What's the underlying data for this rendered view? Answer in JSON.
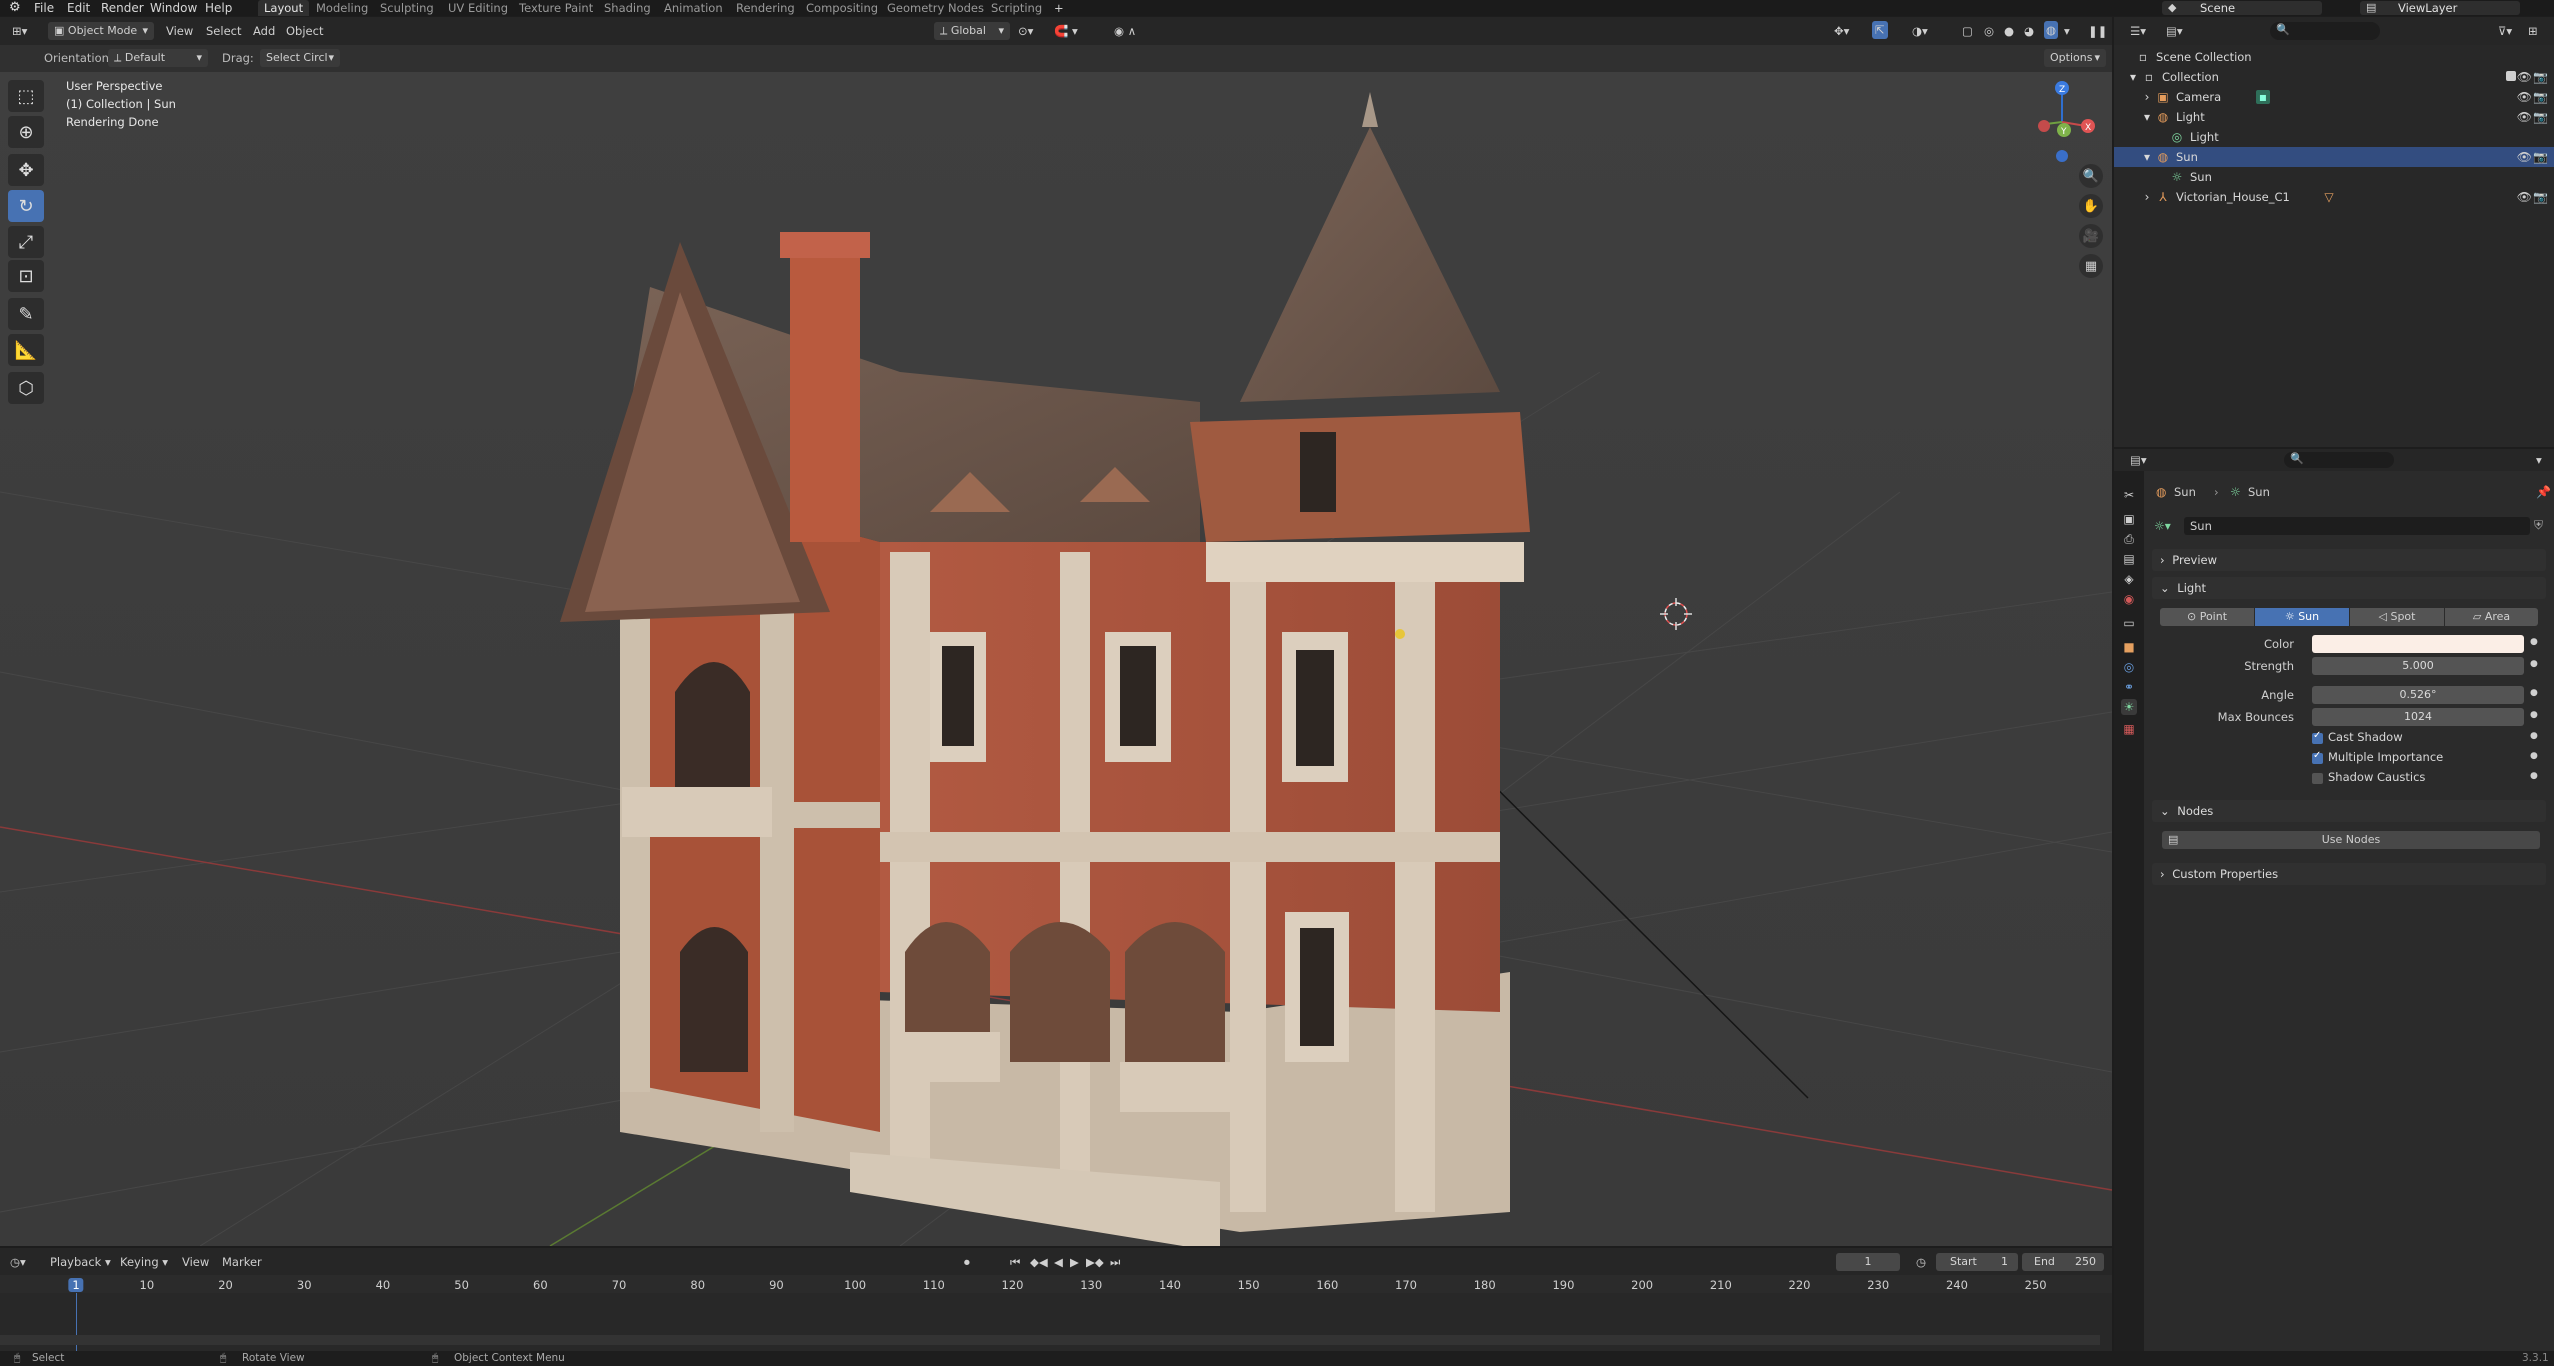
{
  "topbar": {
    "menus": [
      "File",
      "Edit",
      "Render",
      "Window",
      "Help"
    ],
    "workspaces": [
      "Layout",
      "Modeling",
      "Sculpting",
      "UV Editing",
      "Texture Paint",
      "Shading",
      "Animation",
      "Rendering",
      "Compositing",
      "Geometry Nodes",
      "Scripting"
    ],
    "active_workspace": "Layout",
    "scene_label": "Scene",
    "viewlayer_label": "ViewLayer"
  },
  "viewport_header": {
    "mode": "Object Mode",
    "menus": [
      "View",
      "Select",
      "Add",
      "Object"
    ],
    "transform_orientation": "Global",
    "orientation_label": "Orientation:",
    "orientation_value": "Default",
    "drag_label": "Drag:",
    "drag_value": "Select Circl",
    "options_label": "Options"
  },
  "viewport_info": {
    "line1": "User Perspective",
    "line2": "(1) Collection | Sun",
    "line3": "Rendering Done"
  },
  "tools": [
    "select-box",
    "cursor",
    "move",
    "rotate",
    "scale",
    "transform",
    "annotate",
    "measure",
    "add-cube"
  ],
  "active_tool": "rotate",
  "gizmo_axes": {
    "x": "X",
    "y": "Y",
    "z": "Z"
  },
  "timeline": {
    "menus": [
      "Playback",
      "Keying",
      "View",
      "Marker"
    ],
    "current_frame": "1",
    "start_label": "Start",
    "start": "1",
    "end_label": "End",
    "end": "250",
    "ruler": [
      "1",
      "10",
      "20",
      "30",
      "40",
      "50",
      "60",
      "70",
      "80",
      "90",
      "100",
      "110",
      "120",
      "130",
      "140",
      "150",
      "160",
      "170",
      "180",
      "190",
      "200",
      "210",
      "220",
      "230",
      "240",
      "250"
    ]
  },
  "statusbar": {
    "select": "Select",
    "rotate": "Rotate View",
    "context": "Object Context Menu",
    "version": "3.3.1"
  },
  "outliner": {
    "root": "Scene Collection",
    "collection": "Collection",
    "items": [
      {
        "label": "Camera",
        "indent": 1
      },
      {
        "label": "Light",
        "indent": 1
      },
      {
        "label": "Light",
        "indent": 2
      },
      {
        "label": "Sun",
        "indent": 1
      },
      {
        "label": "Sun",
        "indent": 2
      },
      {
        "label": "Victorian_House_C1",
        "indent": 1
      }
    ]
  },
  "properties": {
    "breadcrumb_1": "Sun",
    "breadcrumb_2": "Sun",
    "datablock": "Sun",
    "panel_preview": "Preview",
    "panel_light": "Light",
    "light_types": [
      "Point",
      "Sun",
      "Spot",
      "Area"
    ],
    "active_light_type": "Sun",
    "color_label": "Color",
    "color_value": "#fbeee6",
    "strength_label": "Strength",
    "strength": "5.000",
    "angle_label": "Angle",
    "angle": "0.526°",
    "max_bounces_label": "Max Bounces",
    "max_bounces": "1024",
    "cast_shadow": "Cast Shadow",
    "multiple_importance": "Multiple Importance",
    "shadow_caustics": "Shadow Caustics",
    "panel_nodes": "Nodes",
    "use_nodes": "Use Nodes",
    "panel_custom": "Custom Properties"
  }
}
